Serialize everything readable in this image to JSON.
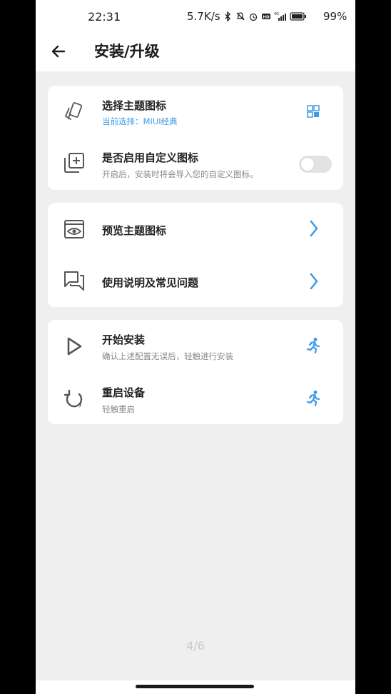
{
  "status_bar": {
    "time": "22:31",
    "network_speed": "5.7K/s",
    "battery_percent": "99%"
  },
  "header": {
    "title": "安装/升级"
  },
  "cards": {
    "card1": {
      "select_theme": {
        "title": "选择主题图标",
        "subtitle": "当前选择：MIUI经典"
      },
      "custom_icons": {
        "title": "是否启用自定义图标",
        "subtitle": "开启后，安装时将会导入您的自定义图标。",
        "toggle_on": false
      }
    },
    "card2": {
      "preview": {
        "title": "预览主题图标"
      },
      "help": {
        "title": "使用说明及常见问题"
      }
    },
    "card3": {
      "install": {
        "title": "开始安装",
        "subtitle": "确认上述配置无误后，轻触进行安装"
      },
      "reboot": {
        "title": "重启设备",
        "subtitle": "轻触重启"
      }
    }
  },
  "pager": "4/6",
  "colors": {
    "accent": "#3d9be9",
    "background": "#efefef",
    "card": "#ffffff"
  }
}
